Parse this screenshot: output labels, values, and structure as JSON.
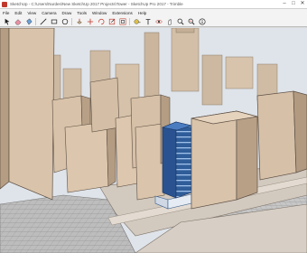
{
  "window": {
    "title": "SketchUp - C:\\Users\\Nurdes\\New SketchUp 2017 Projects\\Tower - SketchUp Pro 2017 - Trimble",
    "minimize_glyph": "–",
    "maximize_glyph": "□",
    "close_glyph": "✕"
  },
  "menubar": {
    "items": [
      "File",
      "Edit",
      "View",
      "Camera",
      "Draw",
      "Tools",
      "Window",
      "Extensions",
      "Help"
    ]
  },
  "toolbar": {
    "tools": [
      "select-icon",
      "eraser-icon",
      "paint-bucket-icon",
      "line-icon",
      "rectangle-icon",
      "circle-icon",
      "push-pull-icon",
      "move-icon",
      "rotate-icon",
      "scale-icon",
      "offset-icon",
      "tape-measure-icon",
      "text-icon",
      "orbit-icon",
      "pan-icon",
      "zoom-icon",
      "zoom-extents-icon",
      "info-icon"
    ]
  },
  "colors": {
    "building": "#d9c3aa",
    "building_shade": "#b59d84",
    "highlight_tower": "#3f6fb0",
    "ground": "#bfbfbf",
    "plaza": "#d4cdc4",
    "sky": "#dde3ea"
  }
}
